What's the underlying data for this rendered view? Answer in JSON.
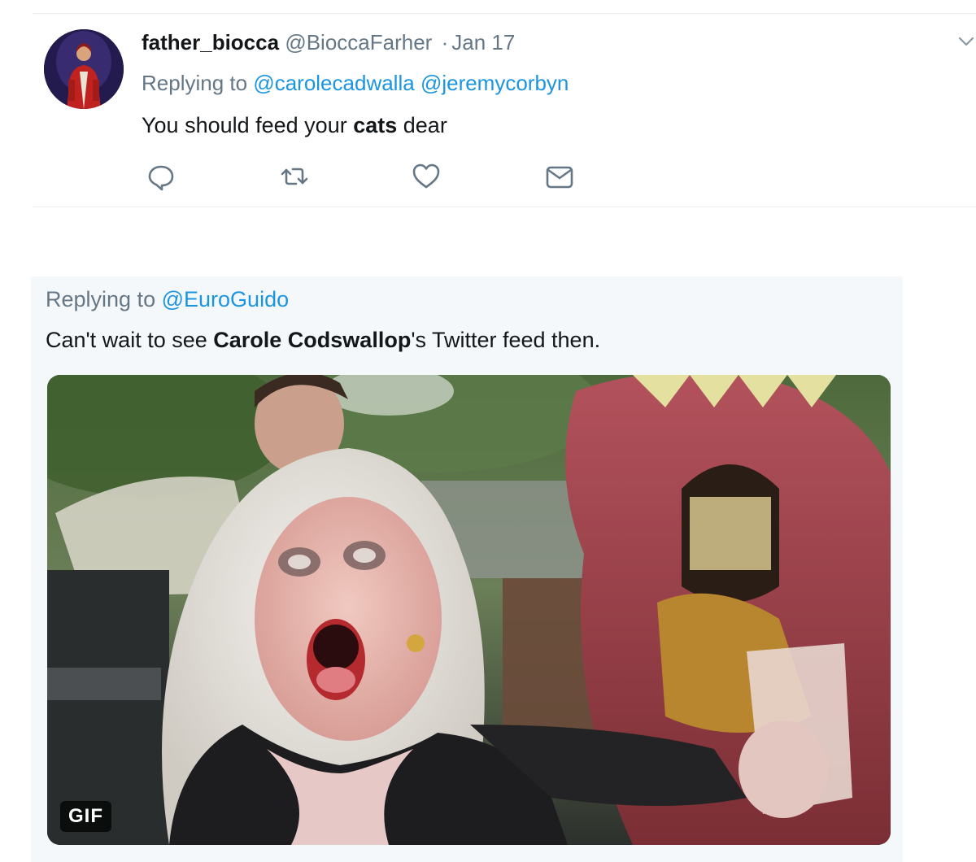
{
  "tweet": {
    "display_name": "father_biocca",
    "handle": "@BioccaFarher",
    "separator": "·",
    "date": "Jan 17",
    "replying_prefix": "Replying to",
    "mentions": [
      "@carolecadwalla",
      "@jeremycorbyn"
    ],
    "text_before": "You should feed your ",
    "text_bold": "cats",
    "text_after": " dear",
    "actions": [
      "reply-icon",
      "retweet-icon",
      "like-icon",
      "direct-message-icon"
    ]
  },
  "quoted": {
    "replying_prefix": "Replying to",
    "mention": "@EuroGuido",
    "text_before": "Can't wait to see ",
    "text_bold": "Carole Codswallop",
    "text_after": "'s Twitter feed then.",
    "media_badge": "GIF"
  },
  "colors": {
    "link": "#1b95e0",
    "secondary_text": "#657786",
    "primary_text": "#14171a",
    "panel_background": "#f5f8fa"
  }
}
